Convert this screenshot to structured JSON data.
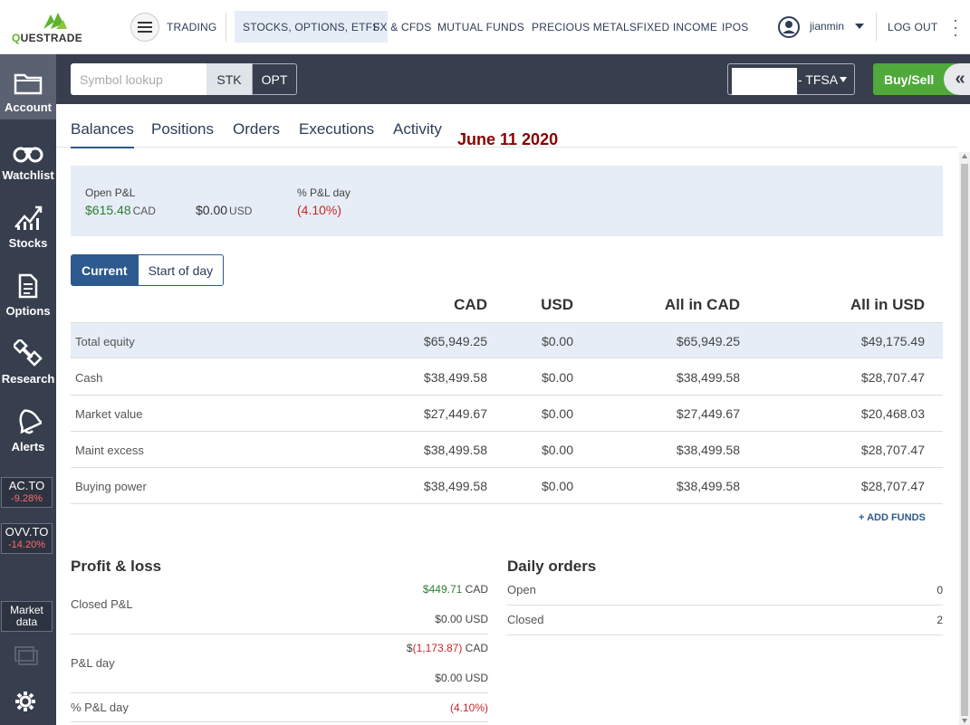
{
  "header": {
    "logo_text": "QUESTRADE",
    "nav": [
      "TRADING",
      "STOCKS, OPTIONS, ETFS",
      "FX & CFDS",
      "MUTUAL FUNDS",
      "PRECIOUS METALS",
      "FIXED INCOME",
      "IPOS"
    ],
    "active_nav": "STOCKS, OPTIONS, ETFS",
    "username": "jianmin",
    "logout": "LOG OUT"
  },
  "sidebar": {
    "items": [
      "Account",
      "Watchlist",
      "Stocks",
      "Options",
      "Research",
      "Alerts"
    ],
    "tickers": [
      {
        "symbol": "AC.TO",
        "change": "-9.28%"
      },
      {
        "symbol": "OVV.TO",
        "change": "-14.20%"
      }
    ],
    "market_data": "Market data"
  },
  "toolbar": {
    "symbol_placeholder": "Symbol lookup",
    "stk": "STK",
    "opt": "OPT",
    "account_label": "- TFSA",
    "buysell": "Buy/Sell",
    "collapse": "«"
  },
  "tabs": [
    "Balances",
    "Positions",
    "Orders",
    "Executions",
    "Activity"
  ],
  "date_note": "June 11 2020",
  "pl_summary": {
    "open_pl_label": "Open P&L",
    "open_pl_cad": "$615.48",
    "open_pl_cad_unit": "CAD",
    "open_pl_usd": "$0.00",
    "open_pl_usd_unit": "USD",
    "pct_label": "% P&L day",
    "pct_value": "(4.10%)"
  },
  "segment": {
    "current": "Current",
    "start": "Start of day"
  },
  "balances": {
    "columns": [
      "CAD",
      "USD",
      "All in CAD",
      "All in USD"
    ],
    "rows": [
      {
        "label": "Total equity",
        "cad": "$65,949.25",
        "usd": "$0.00",
        "all_cad": "$65,949.25",
        "all_usd": "$49,175.49"
      },
      {
        "label": "Cash",
        "cad": "$38,499.58",
        "usd": "$0.00",
        "all_cad": "$38,499.58",
        "all_usd": "$28,707.47"
      },
      {
        "label": "Market value",
        "cad": "$27,449.67",
        "usd": "$0.00",
        "all_cad": "$27,449.67",
        "all_usd": "$20,468.03"
      },
      {
        "label": "Maint excess",
        "cad": "$38,499.58",
        "usd": "$0.00",
        "all_cad": "$38,499.58",
        "all_usd": "$28,707.47"
      },
      {
        "label": "Buying power",
        "cad": "$38,499.58",
        "usd": "$0.00",
        "all_cad": "$38,499.58",
        "all_usd": "$28,707.47"
      }
    ],
    "add_funds": "+ ADD FUNDS"
  },
  "profit_loss": {
    "title": "Profit & loss",
    "closed_label": "Closed P&L",
    "closed_cad": "$449.71",
    "closed_usd": "$0.00",
    "day_label": "P&L day",
    "day_cad_prefix": "$",
    "day_cad": "(1,173.87)",
    "day_usd": "$0.00",
    "pct_label": "% P&L day",
    "pct_value": "(4.10%)",
    "cad_unit": "CAD",
    "usd_unit": "USD"
  },
  "daily_orders": {
    "title": "Daily orders",
    "open_label": "Open",
    "open_value": "0",
    "closed_label": "Closed",
    "closed_value": "2"
  }
}
